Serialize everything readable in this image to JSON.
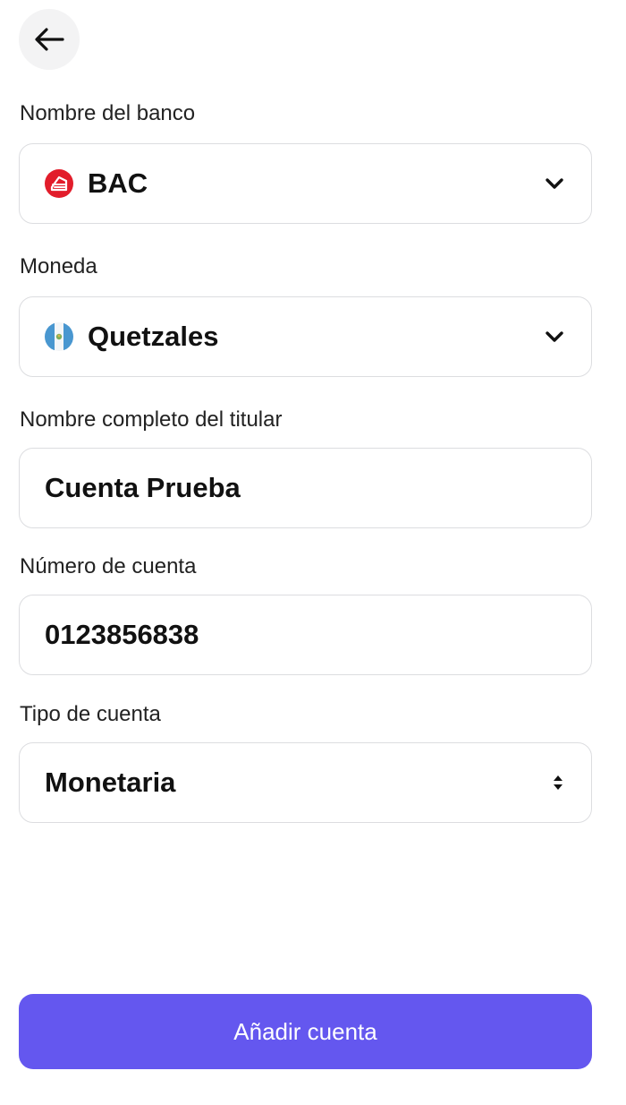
{
  "header": {
    "back_icon": "arrow-left-icon"
  },
  "form": {
    "bank": {
      "label": "Nombre del banco",
      "value": "BAC",
      "icon": "bac-logo-icon",
      "dropdown_icon": "chevron-down-icon"
    },
    "currency": {
      "label": "Moneda",
      "value": "Quetzales",
      "icon": "guatemala-flag-icon",
      "dropdown_icon": "chevron-down-icon"
    },
    "holder_name": {
      "label": "Nombre completo del titular",
      "value": "Cuenta Prueba"
    },
    "account_number": {
      "label": "Número de cuenta",
      "value": "0123856838"
    },
    "account_type": {
      "label": "Tipo de cuenta",
      "value": "Monetaria",
      "dropdown_icon": "up-down-caret-icon"
    }
  },
  "actions": {
    "submit_label": "Añadir cuenta"
  },
  "colors": {
    "primary": "#6457ef",
    "border": "#dcdde0",
    "bac_red": "#e21d2b",
    "flag_blue": "#4997d0"
  }
}
